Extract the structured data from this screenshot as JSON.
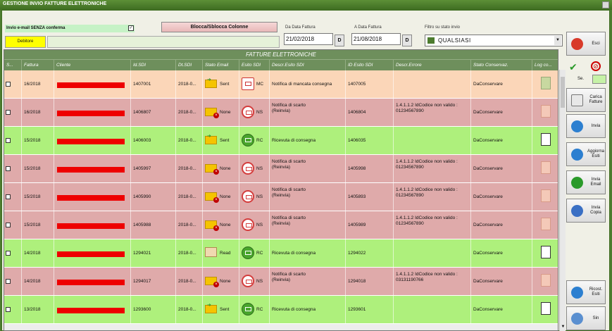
{
  "window": {
    "title": "GESTIONE INVIO FATTURE ELETTRONICHE"
  },
  "toolbar": {
    "invio_label": "Invio e-mail SENZA conferma",
    "invio_checked": "✓",
    "blocca_label": "Blocca/Sblocca Colonne",
    "debitore_label": "Debitore",
    "da_label": "Da Data Fattura",
    "da_value": "21/02/2018",
    "a_label": "A Data Fattura",
    "a_value": "21/08/2018",
    "d_button": "D",
    "filtro_label": "Filtro su stato invio",
    "filtro_value": "QUALSIASI"
  },
  "grid": {
    "title": "FATTURE ELETTRONICHE",
    "columns": [
      "S...",
      "Fattura",
      "Cliente",
      "Id.SDI",
      "Dt.SDI",
      "Stato Email",
      "Esito SDI",
      "Descr.Esito SDI",
      "ID Esito SDI",
      "Descr.Errore",
      "Stato Conservaz.",
      "Log co..."
    ],
    "rows": [
      {
        "bg": "#fbd6b8",
        "fattura": "16/2018",
        "idsdi": "1407001",
        "dtsdi": "2018-0...",
        "email_icon": "closed",
        "email_x": false,
        "email_txt": "Sent",
        "esito_icon": "mc",
        "esito_txt": "MC",
        "descr": "Notifica di mancata consegna",
        "idesito": "1407005",
        "errore": "",
        "conserv": "DaConservare",
        "log": "lgray"
      },
      {
        "bg": "#dfaaaa",
        "fattura": "16/2018",
        "idsdi": "1406807",
        "dtsdi": "2018-0...",
        "email_icon": "closed",
        "email_x": true,
        "email_txt": "None",
        "esito_icon": "ns",
        "esito_txt": "NS",
        "descr": "Notifica di scarto\n(Reinvia)",
        "idesito": "1406804",
        "errore": "1.4.1.1.2 IdCodice non valido :\n01234567890",
        "conserv": "DaConservare",
        "log": "lred"
      },
      {
        "bg": "#aef07c",
        "fattura": "15/2018",
        "idsdi": "1406003",
        "dtsdi": "2018-0...",
        "email_icon": "closed",
        "email_x": false,
        "email_txt": "Sent",
        "esito_icon": "rc",
        "esito_txt": "RC",
        "descr": "Ricevuta di consegna",
        "idesito": "1406035",
        "errore": "",
        "conserv": "DaConservare",
        "log": "lfile"
      },
      {
        "bg": "#dfaaaa",
        "fattura": "15/2018",
        "idsdi": "1405997",
        "dtsdi": "2018-0...",
        "email_icon": "closed",
        "email_x": true,
        "email_txt": "None",
        "esito_icon": "ns",
        "esito_txt": "NS",
        "descr": "Notifica di scarto\n(Reinvia)",
        "idesito": "1405998",
        "errore": "1.4.1.1.2 IdCodice non valido :\n01234567890",
        "conserv": "DaConservare",
        "log": "lred"
      },
      {
        "bg": "#dfaaaa",
        "fattura": "15/2018",
        "idsdi": "1405990",
        "dtsdi": "2018-0...",
        "email_icon": "closed",
        "email_x": true,
        "email_txt": "None",
        "esito_icon": "ns",
        "esito_txt": "NS",
        "descr": "Notifica di scarto\n(Reinvia)",
        "idesito": "1405893",
        "errore": "1.4.1.1.2 IdCodice non valido :\n01234567890",
        "conserv": "DaConservare",
        "log": "lred"
      },
      {
        "bg": "#dfaaaa",
        "fattura": "15/2018",
        "idsdi": "1405988",
        "dtsdi": "2018-0...",
        "email_icon": "closed",
        "email_x": true,
        "email_txt": "None",
        "esito_icon": "ns",
        "esito_txt": "NS",
        "descr": "Notifica di scarto\n(Reinvia)",
        "idesito": "1405989",
        "errore": "1.4.1.1.2 IdCodice non valido :\n01234567890",
        "conserv": "DaConservare",
        "log": "lred"
      },
      {
        "bg": "#aef07c",
        "fattura": "14/2018",
        "idsdi": "1294021",
        "dtsdi": "2018-0...",
        "email_icon": "open",
        "email_x": false,
        "email_txt": "Read",
        "esito_icon": "rc",
        "esito_txt": "RC",
        "descr": "Ricevuta di consegna",
        "idesito": "1294022",
        "errore": "",
        "conserv": "DaConservare",
        "log": "lfile"
      },
      {
        "bg": "#dfaaaa",
        "fattura": "14/2018",
        "idsdi": "1294017",
        "dtsdi": "2018-0...",
        "email_icon": "closed",
        "email_x": true,
        "email_txt": "None",
        "esito_icon": "ns",
        "esito_txt": "NS",
        "descr": "Notifica di scarto\n(Reinvia)",
        "idesito": "1294018",
        "errore": "1.4.1.1.2 IdCodice non valido :\n03131190766",
        "conserv": "DaConservare",
        "log": "lred"
      },
      {
        "bg": "#aef07c",
        "fattura": "13/2018",
        "idsdi": "1293600",
        "dtsdi": "2018-0...",
        "email_icon": "closed",
        "email_x": false,
        "email_txt": "Sent",
        "esito_icon": "rc",
        "esito_txt": "RC",
        "descr": "Ricevuta di consegna",
        "idesito": "1293601",
        "errore": "",
        "conserv": "DaConservare",
        "log": "lfile"
      }
    ]
  },
  "sidebar": {
    "esci": "Esci",
    "sel_label": "Se.",
    "carica": "Carica\nFatture",
    "invia": "Invia",
    "aggiorna": "Aggiorna\nEsiti",
    "invia_email": "Invia\nEmail",
    "invia_copia": "Invia\nCopia",
    "ricost": "Ricost.\nEsiti",
    "sin": "Sin",
    "icon_colors": {
      "esci": "#d83a2a",
      "globe": "#2c7fd0",
      "email": "#2a9a2a",
      "xml": "#3a6fc4",
      "sin": "#5a8fd0"
    }
  }
}
